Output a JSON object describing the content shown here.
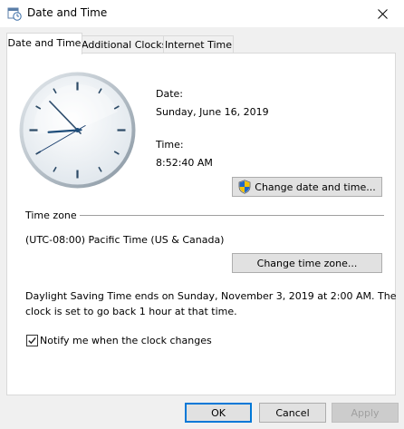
{
  "window": {
    "title": "Date and Time",
    "icon": "date-time-icon"
  },
  "tabs": [
    {
      "label": "Date and Time",
      "active": true
    },
    {
      "label": "Additional Clocks",
      "active": false
    },
    {
      "label": "Internet Time",
      "active": false
    }
  ],
  "datetime": {
    "date_label": "Date:",
    "date_value": "Sunday, June 16, 2019",
    "time_label": "Time:",
    "time_value": "8:52:40 AM",
    "change_button": "Change date and time...",
    "shield_icon": "uac-shield-icon"
  },
  "clock": {
    "hours": 8,
    "minutes": 52,
    "seconds": 40
  },
  "timezone": {
    "heading": "Time zone",
    "value": "(UTC-08:00) Pacific Time (US & Canada)",
    "change_button": "Change time zone..."
  },
  "dst": {
    "line1": "Daylight Saving Time ends on Sunday, November 3, 2019 at 2:00 AM. The",
    "line2": "clock is set to go back 1 hour at that time."
  },
  "notify": {
    "label": "Notify me when the clock changes",
    "checked": true
  },
  "buttons": {
    "ok": "OK",
    "cancel": "Cancel",
    "apply": "Apply"
  },
  "colors": {
    "accent": "#0078d7",
    "clock_face": "#f4f7fa",
    "clock_rim": "#9aa7b2",
    "second_hand": "#1a3f6e"
  }
}
